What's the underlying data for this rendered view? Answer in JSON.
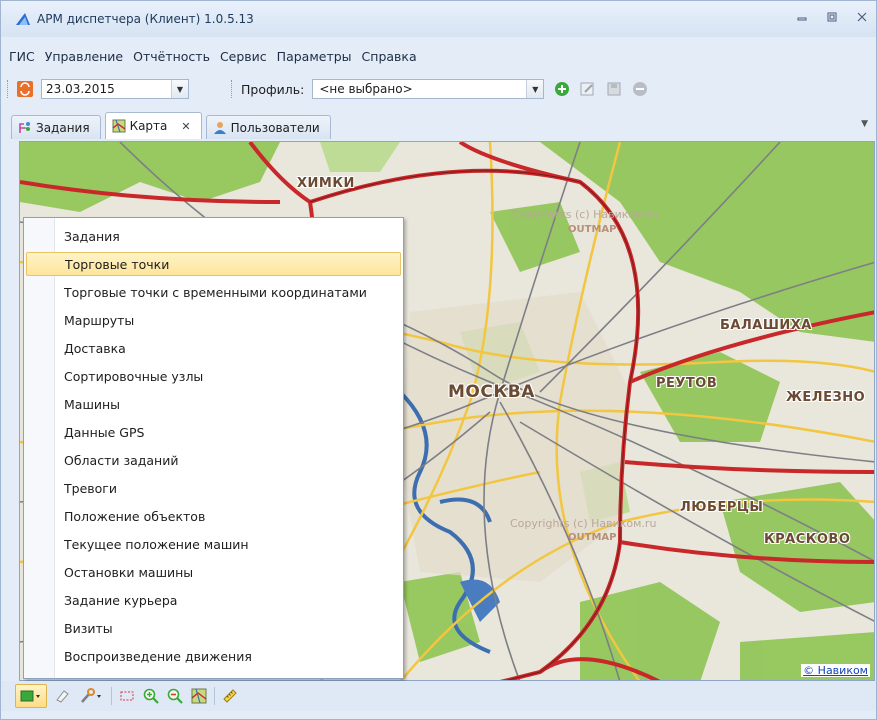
{
  "window": {
    "title": "АРМ диспетчера (Клиент) 1.0.5.13"
  },
  "menu": {
    "items": [
      "ГИС",
      "Управление",
      "Отчётность",
      "Сервис",
      "Параметры",
      "Справка"
    ]
  },
  "toolbar": {
    "date_value": "23.03.2015",
    "profile_label": "Профиль:",
    "profile_value": "<не выбрано>"
  },
  "tabs": [
    {
      "label": "Задания"
    },
    {
      "label": "Карта"
    },
    {
      "label": "Пользователи"
    }
  ],
  "map": {
    "labels": {
      "khimki": "ХИМКИ",
      "moskva": "МОСКВА",
      "balashikha": "БАЛАШИХА",
      "reutov": "РЕУТОВ",
      "zheleznodor": "ЖЕЛЕЗНО",
      "lyubertsy": "ЛЮБЕРЦЫ",
      "krasково": "КРАСКОВО"
    },
    "copyright_1": "Copyrights (c) Навиком.ru",
    "copyright_2": "Copyrights (c) Навиком.ru",
    "outmap_1": "OUTMAP",
    "outmap_2": "OUTMAP",
    "attribution": "© Навиком"
  },
  "layers_menu": {
    "items": [
      "Задания",
      "Торговые точки",
      "Торговые точки с временными координатами",
      "Маршруты",
      "Доставка",
      "Сортировочные узлы",
      "Машины",
      "Данные GPS",
      "Области заданий",
      "Тревоги",
      "Положение объектов",
      "Текущее положение машин",
      "Остановки машины",
      "Задание курьера",
      "Визиты",
      "Воспроизведение движения"
    ],
    "highlighted": "Торговые точки"
  },
  "colors": {
    "accent_highlight": "#fde59b",
    "road_main": "#c8282a",
    "road_secondary": "#f2c640",
    "water": "#3d6fb0",
    "forest": "#8cc24a"
  }
}
